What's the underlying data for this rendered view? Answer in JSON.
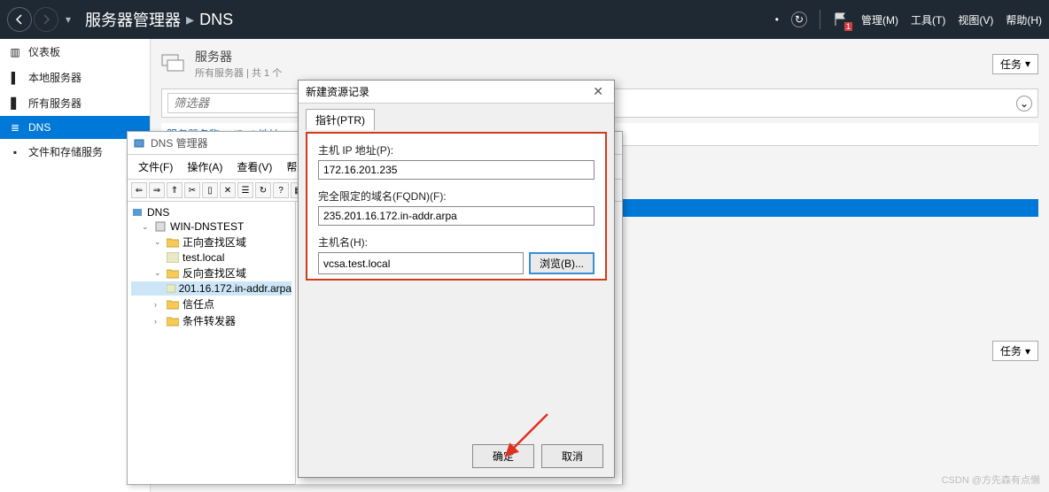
{
  "topbar": {
    "title": "服务器管理器",
    "sub": "DNS",
    "menus": {
      "manage": "管理(M)",
      "tools": "工具(T)",
      "view": "视图(V)",
      "help": "帮助(H)"
    },
    "flag_badge": "1"
  },
  "sidebar": {
    "items": [
      {
        "label": "仪表板"
      },
      {
        "label": "本地服务器"
      },
      {
        "label": "所有服务器"
      },
      {
        "label": "DNS"
      },
      {
        "label": "文件和存储服务"
      }
    ]
  },
  "content": {
    "server_title": "服务器",
    "server_sub": "所有服务器 | 共 1 个",
    "tasks": "任务",
    "filter_placeholder": "筛选器",
    "col1": "服务器名称",
    "col2": "IPv4 地址"
  },
  "dns_window": {
    "title": "DNS 管理器",
    "menu": {
      "file": "文件(F)",
      "action": "操作(A)",
      "view": "查看(V)",
      "help": "帮助(H)"
    },
    "tree": {
      "root": "DNS",
      "server": "WIN-DNSTEST",
      "fwd": "正向查找区域",
      "fwd_zone": "test.local",
      "rev": "反向查找区域",
      "rev_zone": "201.16.172.in-addr.arpa",
      "trust": "信任点",
      "cond": "条件转发器"
    }
  },
  "dialog": {
    "title": "新建资源记录",
    "tab": "指针(PTR)",
    "ip_label": "主机 IP 地址(P):",
    "ip_value": "172.16.201.235",
    "fqdn_label": "完全限定的域名(FQDN)(F):",
    "fqdn_value": "235.201.16.172.in-addr.arpa",
    "host_label": "主机名(H):",
    "host_value": "vcsa.test.local",
    "browse": "浏览(B)...",
    "ok": "确定",
    "cancel": "取消"
  },
  "watermark": "CSDN @方先森有点懒"
}
